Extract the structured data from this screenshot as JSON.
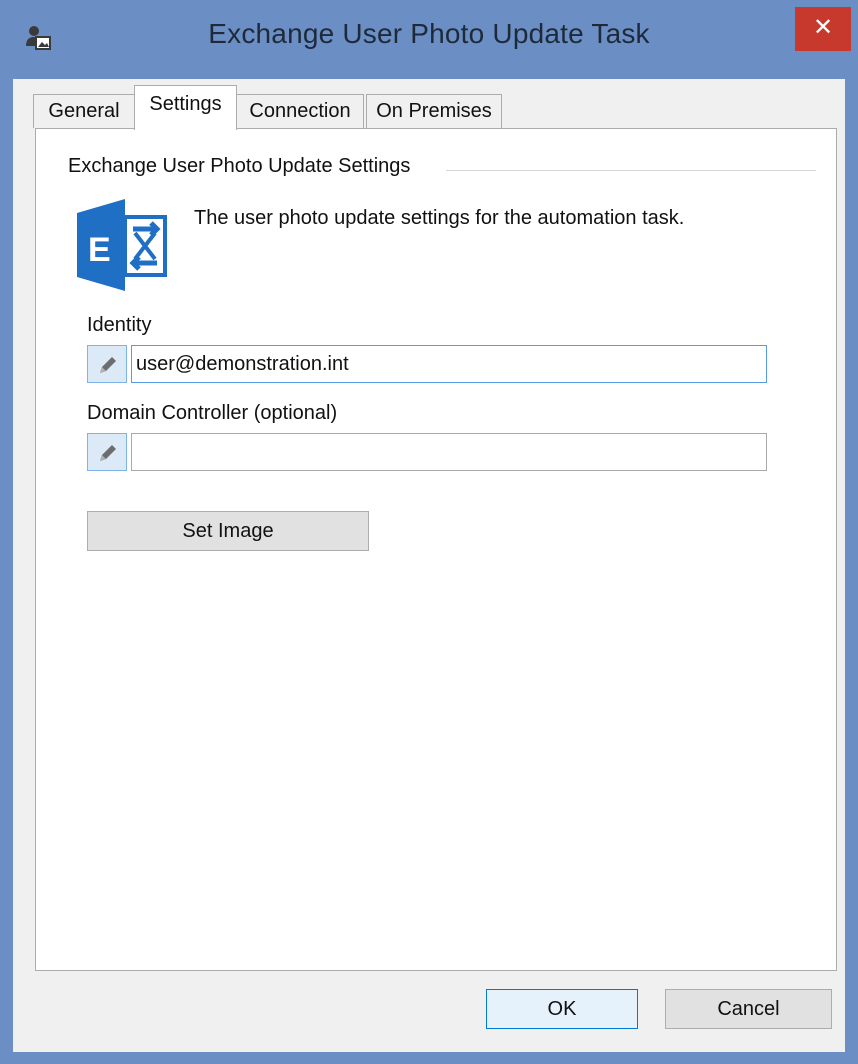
{
  "window": {
    "title": "Exchange User Photo Update Task",
    "close_label": "✕",
    "accent_color": "#6b8fc4",
    "close_color": "#c7392d"
  },
  "tabs": [
    {
      "label": "General",
      "active": false
    },
    {
      "label": "Settings",
      "active": true
    },
    {
      "label": "Connection",
      "active": false
    },
    {
      "label": "On Premises",
      "active": false
    }
  ],
  "settings": {
    "section_title": "Exchange User Photo Update Settings",
    "description": "The user photo update settings for the automation task.",
    "logo_icon": "exchange-logo",
    "identity": {
      "label": "Identity",
      "value": "user@demonstration.int",
      "edit_icon": "pencil-icon"
    },
    "domain_controller": {
      "label": "Domain Controller (optional)",
      "value": "",
      "edit_icon": "pencil-icon"
    },
    "set_image_label": "Set Image"
  },
  "footer": {
    "ok_label": "OK",
    "cancel_label": "Cancel"
  }
}
